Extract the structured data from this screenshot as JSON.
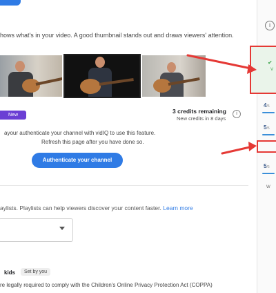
{
  "header": {
    "thumbnail_description": "hows what's in your video. A good thumbnail stands out and draws viewers' attention."
  },
  "new_badge": {
    "label": "New",
    "icon": "sparkle-icon"
  },
  "credits": {
    "title": "3 credits remaining",
    "subtitle": "New credits in 8 days"
  },
  "auth": {
    "line1": "ayour authenticate your channel with vidIQ to use this feature.",
    "line2": "Refresh this page after you have done so.",
    "button": "Authenticate your channel"
  },
  "playlists": {
    "text": "aylists. Playlists can help viewers discover your content faster.",
    "link": "Learn more"
  },
  "kids": {
    "label": "kids",
    "badge": "Set by you",
    "text1": "re legally required to comply with the Children's Online Privacy Protection Act (COPPA)",
    "text2": "..."
  },
  "sidebar": {
    "info_icon": "i",
    "checklist_label": "V",
    "scores": [
      {
        "value": "4",
        "max": "/5"
      },
      {
        "value": "5",
        "max": "/5"
      },
      {
        "value": "5",
        "max": "/5"
      }
    ],
    "small_label": "W"
  },
  "colors": {
    "accent": "#2f7be5",
    "purple": "#6b3fd4",
    "arrow_red": "#e53935"
  }
}
